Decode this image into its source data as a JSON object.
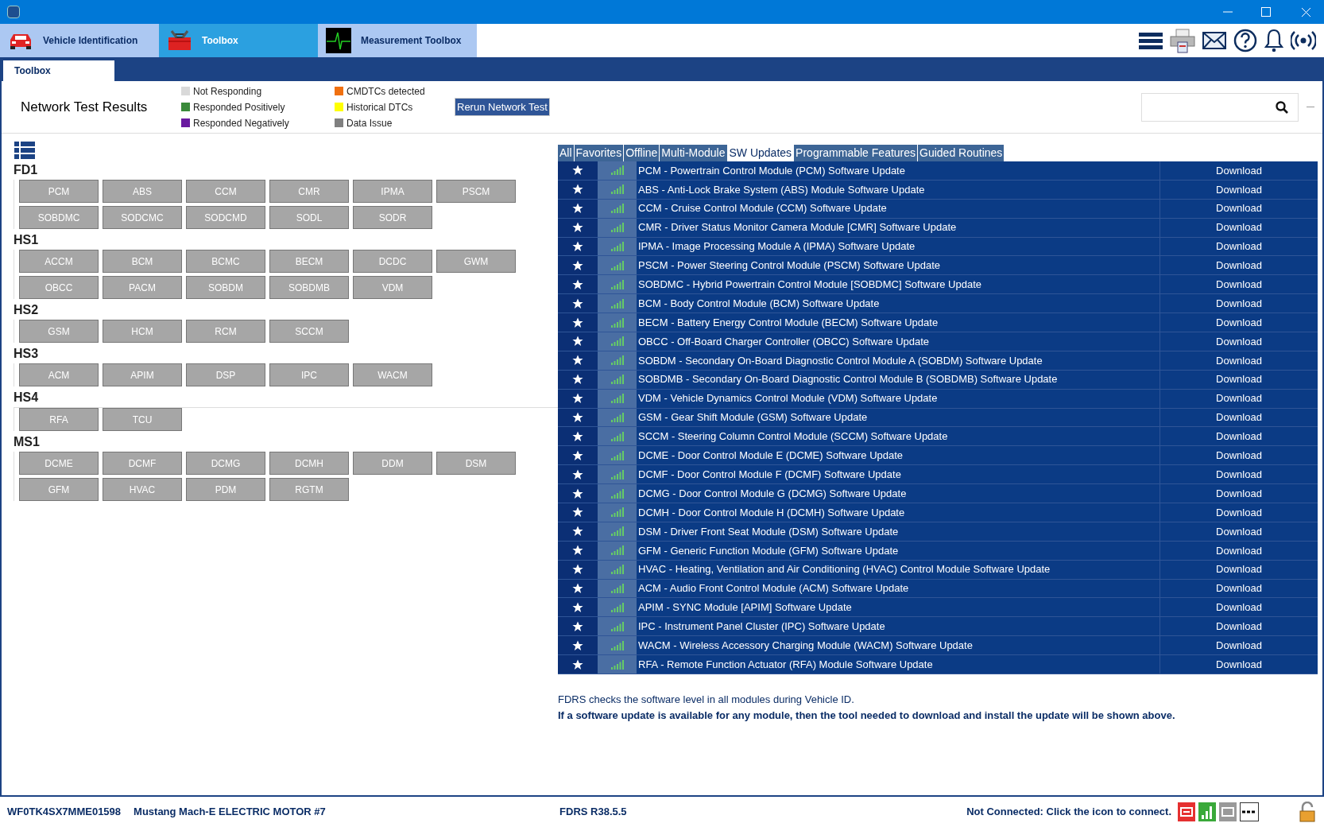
{
  "app_tabs": [
    {
      "label": "Vehicle Identification",
      "selected": false,
      "kind": "car"
    },
    {
      "label": "Toolbox",
      "selected": true,
      "kind": "toolbox"
    },
    {
      "label": "Measurement Toolbox",
      "selected": false,
      "kind": "scope"
    }
  ],
  "sub_tabs": [
    {
      "label": "Toolbox",
      "selected": true
    }
  ],
  "network": {
    "title": "Network Test Results",
    "legend": [
      {
        "label": "Not Responding",
        "color": "#d9d9d9"
      },
      {
        "label": "Responded Positively",
        "color": "#3a8a3a"
      },
      {
        "label": "Responded Negatively",
        "color": "#6a1aa0"
      },
      {
        "label": "CMDTCs detected",
        "color": "#f07010"
      },
      {
        "label": "Historical DTCs",
        "color": "#ffff00"
      },
      {
        "label": "Data Issue",
        "color": "#808080"
      }
    ],
    "rerun_button": "Rerun Network Test"
  },
  "groups": [
    {
      "name": "FD1",
      "modules": [
        "PCM",
        "ABS",
        "CCM",
        "CMR",
        "IPMA",
        "PSCM",
        "SOBDMC",
        "SODCMC",
        "SODCMD",
        "SODL",
        "SODR"
      ]
    },
    {
      "name": "HS1",
      "modules": [
        "ACCM",
        "BCM",
        "BCMC",
        "BECM",
        "DCDC",
        "GWM",
        "OBCC",
        "PACM",
        "SOBDM",
        "SOBDMB",
        "VDM"
      ]
    },
    {
      "name": "HS2",
      "modules": [
        "GSM",
        "HCM",
        "RCM",
        "SCCM"
      ]
    },
    {
      "name": "HS3",
      "modules": [
        "ACM",
        "APIM",
        "DSP",
        "IPC",
        "WACM"
      ]
    },
    {
      "name": "HS4",
      "modules": [
        "RFA",
        "TCU"
      ]
    },
    {
      "name": "MS1",
      "modules": [
        "DCME",
        "DCMF",
        "DCMG",
        "DCMH",
        "DDM",
        "DSM",
        "GFM",
        "HVAC",
        "PDM",
        "RGTM"
      ]
    }
  ],
  "filter_tabs": [
    {
      "label": "All",
      "selected": false
    },
    {
      "label": "Favorites",
      "selected": false
    },
    {
      "label": "Offline",
      "selected": false
    },
    {
      "label": "Multi-Module",
      "selected": false
    },
    {
      "label": "SW Updates",
      "selected": true
    },
    {
      "label": "Programmable Features",
      "selected": false
    },
    {
      "label": "Guided Routines",
      "selected": false
    }
  ],
  "routines": [
    {
      "name": "PCM - Powertrain Control Module (PCM) Software Update",
      "action": "Download"
    },
    {
      "name": "ABS - Anti-Lock Brake System (ABS) Module Software Update",
      "action": "Download"
    },
    {
      "name": "CCM - Cruise Control Module (CCM) Software Update",
      "action": "Download"
    },
    {
      "name": "CMR - Driver Status Monitor Camera Module [CMR] Software Update",
      "action": "Download"
    },
    {
      "name": "IPMA - Image Processing Module A (IPMA) Software Update",
      "action": "Download"
    },
    {
      "name": "PSCM - Power Steering Control Module (PSCM) Software Update",
      "action": "Download"
    },
    {
      "name": "SOBDMC - Hybrid Powertrain Control Module [SOBDMC] Software Update",
      "action": "Download"
    },
    {
      "name": "BCM - Body Control Module (BCM) Software Update",
      "action": "Download"
    },
    {
      "name": "BECM - Battery Energy Control Module (BECM) Software Update",
      "action": "Download"
    },
    {
      "name": "OBCC - Off-Board Charger Controller (OBCC) Software Update",
      "action": "Download"
    },
    {
      "name": "SOBDM - Secondary On-Board Diagnostic Control Module A (SOBDM) Software Update",
      "action": "Download"
    },
    {
      "name": "SOBDMB - Secondary On-Board Diagnostic Control Module B (SOBDMB) Software Update",
      "action": "Download"
    },
    {
      "name": "VDM - Vehicle Dynamics Control Module (VDM) Software Update",
      "action": "Download"
    },
    {
      "name": "GSM - Gear Shift Module (GSM) Software Update",
      "action": "Download"
    },
    {
      "name": "SCCM - Steering Column Control Module (SCCM) Software Update",
      "action": "Download"
    },
    {
      "name": "DCME - Door Control Module E (DCME) Software Update",
      "action": "Download"
    },
    {
      "name": "DCMF - Door Control Module F (DCMF) Software Update",
      "action": "Download"
    },
    {
      "name": "DCMG - Door Control Module G (DCMG) Software Update",
      "action": "Download"
    },
    {
      "name": "DCMH - Door Control Module H (DCMH) Software Update",
      "action": "Download"
    },
    {
      "name": "DSM - Driver Front Seat Module (DSM) Software Update",
      "action": "Download"
    },
    {
      "name": "GFM - Generic Function Module (GFM) Software Update",
      "action": "Download"
    },
    {
      "name": "HVAC - Heating, Ventilation and Air Conditioning (HVAC) Control Module Software Update",
      "action": "Download"
    },
    {
      "name": "ACM - Audio Front Control Module (ACM) Software Update",
      "action": "Download"
    },
    {
      "name": "APIM - SYNC Module [APIM] Software Update",
      "action": "Download"
    },
    {
      "name": "IPC - Instrument Panel Cluster (IPC) Software Update",
      "action": "Download"
    },
    {
      "name": "WACM - Wireless Accessory Charging Module (WACM) Software Update",
      "action": "Download"
    },
    {
      "name": "RFA - Remote Function Actuator (RFA) Module Software Update",
      "action": "Download"
    }
  ],
  "notes": [
    "FDRS checks the software level in all modules during Vehicle ID.",
    "If a software update is available for any module, then the tool needed to download and install the update will be shown above."
  ],
  "status_bar": {
    "vin": "WF0TK4SX7MME01598",
    "vehicle": "Mustang Mach-E ELECTRIC MOTOR #7",
    "version": "FDRS R38.5.5",
    "connection": "Not Connected: Click the icon to connect."
  }
}
